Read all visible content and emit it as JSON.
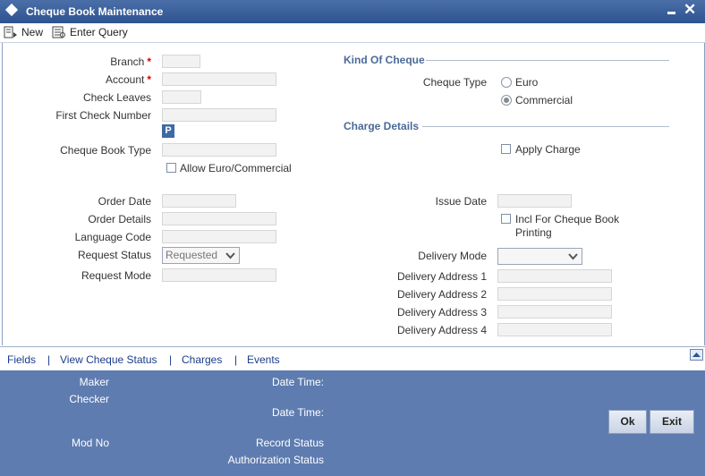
{
  "window": {
    "title": "Cheque Book Maintenance"
  },
  "toolbar": {
    "new_label": "New",
    "enter_query_label": "Enter Query"
  },
  "left": {
    "branch_label": "Branch",
    "account_label": "Account",
    "check_leaves_label": "Check Leaves",
    "first_check_number_label": "First Check Number",
    "p_button": "P",
    "cheque_book_type_label": "Cheque Book Type",
    "allow_euro_label": "Allow Euro/Commercial",
    "order_date_label": "Order Date",
    "order_details_label": "Order Details",
    "language_code_label": "Language Code",
    "request_status_label": "Request Status",
    "request_status_value": "Requested",
    "request_mode_label": "Request Mode",
    "required_mark": "*"
  },
  "right": {
    "kind_section": "Kind Of Cheque",
    "cheque_type_label": "Cheque Type",
    "option_euro": "Euro",
    "option_commercial": "Commercial",
    "selected_cheque_type": "Commercial",
    "charge_section": "Charge Details",
    "apply_charge_label": "Apply Charge",
    "issue_date_label": "Issue Date",
    "incl_printing_label_1": "Incl For Cheque Book",
    "incl_printing_label_2": "Printing",
    "delivery_mode_label": "Delivery Mode",
    "delivery_address_1_label": "Delivery Address 1",
    "delivery_address_2_label": "Delivery Address 2",
    "delivery_address_3_label": "Delivery Address 3",
    "delivery_address_4_label": "Delivery Address 4"
  },
  "tabs": {
    "fields": "Fields",
    "view_cheque_status": "View Cheque Status",
    "charges": "Charges",
    "events": "Events",
    "separator": "|"
  },
  "footer": {
    "maker_label": "Maker",
    "checker_label": "Checker",
    "date_time_label": "Date Time:",
    "mod_no_label": "Mod No",
    "record_status_label": "Record Status",
    "authorization_status_label": "Authorization Status",
    "ok_label": "Ok",
    "exit_label": "Exit"
  },
  "colors": {
    "titlebar": "#2d5390",
    "footer": "#5e7cb0",
    "section": "#4a6a9a",
    "link": "#1a3c8a"
  }
}
